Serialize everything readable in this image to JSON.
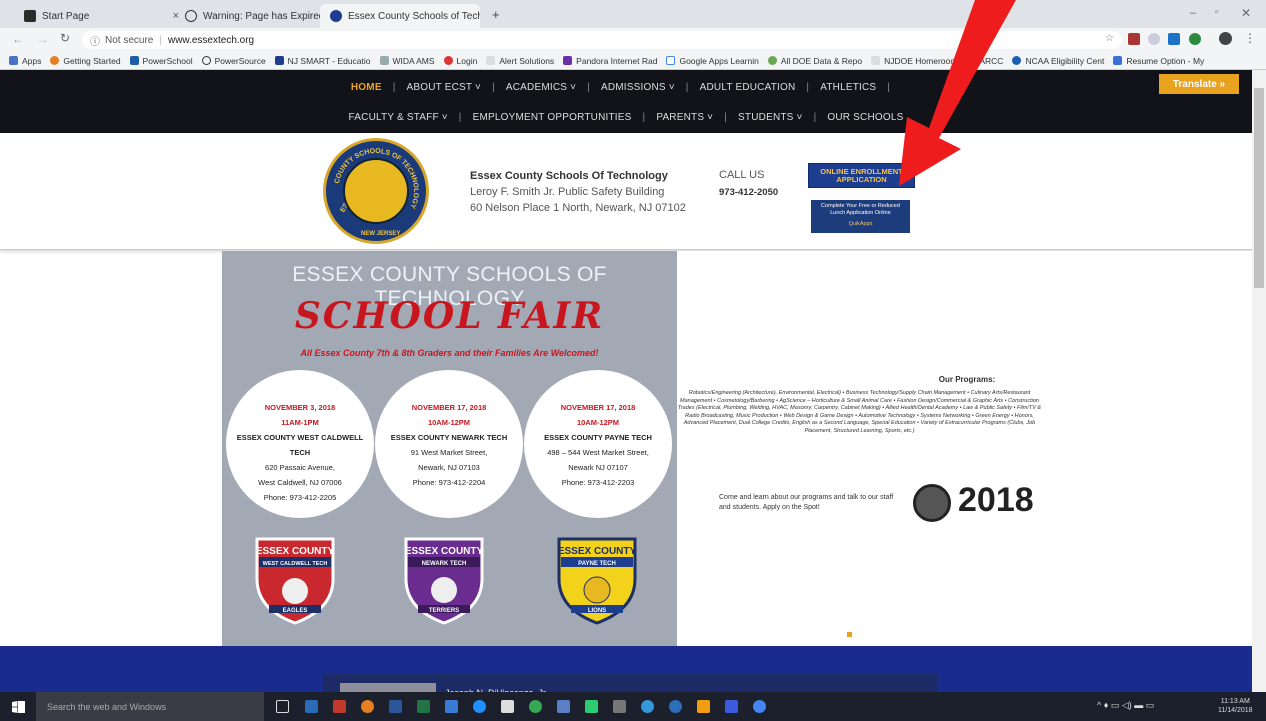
{
  "browser": {
    "tabs": [
      {
        "title": "Start Page",
        "close": "×"
      },
      {
        "title": "Warning: Page has Expired",
        "close": "×"
      },
      {
        "title": "Essex County Schools of Technol",
        "close": "×"
      }
    ],
    "new_tab": "+",
    "security": "Not secure",
    "url": "www.essextech.org",
    "bookmarks": [
      "Apps",
      "Getting Started",
      "PowerSchool",
      "PowerSource",
      "NJ SMART - Educatio",
      "WIDA AMS",
      "Login",
      "Alert Solutions",
      "Pandora Internet Rad",
      "Google Apps Learnin",
      "All DOE Data & Repo",
      "NJDOE Homeroom",
      "ARCC",
      "NCAA Eligibility Cent",
      "Resume Option - My"
    ]
  },
  "nav": {
    "row1": [
      "HOME",
      "ABOUT ECST ˅",
      "ACADEMICS ˅",
      "ADMISSIONS ˅",
      "ADULT EDUCATION",
      "ATHLETICS"
    ],
    "row2": [
      "FACULTY & STAFF ˅",
      "EMPLOYMENT OPPORTUNITIES",
      "PARENTS ˅",
      "STUDENTS ˅",
      "OUR SCHOOLS"
    ],
    "translate": "Translate »"
  },
  "header": {
    "seal_top": "COUNTY SCHOOLS OF TECHNOLOGY",
    "seal_left": "ESSEX",
    "seal_bottom": "NEW JERSEY",
    "school_name": "Essex County Schools Of Technology",
    "building": "Leroy F. Smith Jr. Public Safety Building",
    "address": "60 Nelson Place 1 North, Newark, NJ 07102",
    "call_label": "CALL US",
    "phone": "973-412-2050",
    "enroll_line1": "ONLINE ENROLLMENT",
    "enroll_line2": "APPLICATION",
    "lunch_line1": "Complete Your Free or Reduced",
    "lunch_line2": "Lunch Application Online",
    "lunch_brand": "QuikApps"
  },
  "flyer": {
    "title": "ESSEX COUNTY SCHOOLS OF TECHNOLOGY",
    "headline": "SCHOOL FAIR",
    "subtitle": "All Essex County 7th & 8th Graders and their Families Are Welcomed!",
    "events": [
      {
        "date": "NOVEMBER 3, 2018",
        "time": "11AM-1PM",
        "school": "ESSEX COUNTY WEST CALDWELL TECH",
        "street": "620 Passaic Avenue,",
        "city": "West Caldwell, NJ 07006",
        "phone": "Phone: 973-412-2205",
        "shield_top": "ESSEX COUNTY",
        "shield_mid": "WEST CALDWELL TECH",
        "shield_bottom": "EAGLES",
        "color": "#c8282e"
      },
      {
        "date": "NOVEMBER 17, 2018",
        "time": "10AM-12PM",
        "school": "ESSEX COUNTY NEWARK TECH",
        "street": "91 West Market Street,",
        "city": "Newark, NJ 07103",
        "phone": "Phone: 973-412-2204",
        "shield_top": "ESSEX COUNTY",
        "shield_mid": "NEWARK TECH",
        "shield_bottom": "TERRIERS",
        "color": "#6a2c8e"
      },
      {
        "date": "NOVEMBER 17, 2018",
        "time": "10AM-12PM",
        "school": "ESSEX COUNTY PAYNE TECH",
        "street": "498 – 544 West Market Street,",
        "city": "Newark NJ 07107",
        "phone": "Phone: 973-412-2203",
        "shield_top": "ESSEX COUNTY",
        "shield_mid": "PAYNE TECH",
        "shield_bottom": "LIONS",
        "color": "#f2d21b"
      }
    ],
    "programs_heading": "Our Programs:",
    "programs_text": "Robotics/Engineering (Architecture), Environmental, Electrical) • Business Technology/Supply Chain Management • Culinary Arts/Restaurant Management • Cosmetology/Barbering • AgScience – Horticulture & Small Animal Care • Fashion Design/Commercial & Graphic Arts • Construction Trades (Electrical, Plumbing, Welding, HVAC, Masonry, Carpentry, Cabinet Making) • Allied Health/Dental Academy • Law & Public Safety • Film/TV & Radio Broadcasting, Music Production • Web Design & Game Design • Automotive Technology • Systems Networking • Green Energy • Honors, Advanced Placement, Dual College Credits, English as a Second Language, Special Education • Variety of Extracurricular Programs (Clubs, Job Placement, Structured Learning, Sports, etc.)",
    "come_text": "Come and learn about our programs and talk to our staff and students.  Apply on the Spot!",
    "year": "2018"
  },
  "footer": {
    "person": "Joseph N. DiVincenzo, Jr."
  },
  "taskbar": {
    "search": "Search the web and Windows",
    "time": "11:13 AM",
    "date": "11/14/2018"
  },
  "annotation": {
    "arrow_color": "#ee1c1c"
  }
}
